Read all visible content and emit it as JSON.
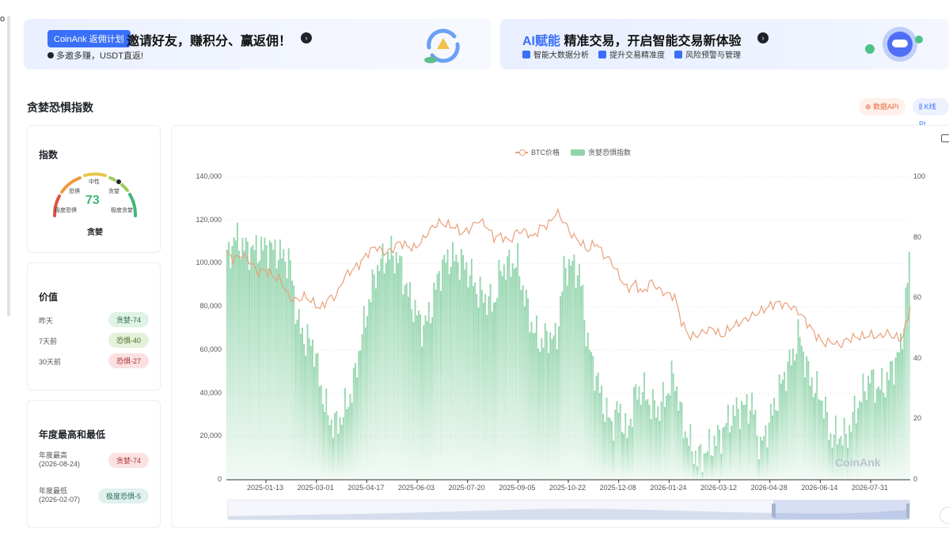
{
  "left_stub": "o",
  "banner1": {
    "badge": "CoinAnk 返佣计划",
    "title": "邀请好友，赚积分、赢返佣！",
    "subtitle": "多邀多赚，USDT直返!"
  },
  "banner2": {
    "title_ai": "AI赋能",
    "title_rest": " 精准交易，开启智能交易新体验",
    "features": [
      "智能大数据分析",
      "提升交易精准度",
      "风险预警与管理"
    ]
  },
  "page_title": "贪婪恐惧指数",
  "buttons": {
    "data_api": "数据API",
    "kline": "K线 PI"
  },
  "index_card": {
    "title": "指数",
    "value": "73",
    "state": "贪婪",
    "zones": {
      "extreme_fear": "极度恐惧",
      "fear": "恐惧",
      "neutral": "中性",
      "greed": "贪婪",
      "extreme_greed": "极度贪婪"
    },
    "colors": {
      "red": "#e0523f",
      "orange": "#ef9a3d",
      "yellow": "#e8c64a",
      "lightgreen": "#9fcd5a",
      "green": "#3fb877"
    }
  },
  "value_card": {
    "title": "价值",
    "rows": [
      {
        "label": "昨天",
        "chip": "贪婪-74"
      },
      {
        "label": "7天前",
        "chip": "恐惧-40"
      },
      {
        "label": "30天前",
        "chip": "恐惧-27"
      }
    ]
  },
  "year_card": {
    "title": "年度最高和最低",
    "rows": [
      {
        "label1": "年度最高",
        "label2": "(2026-08-24)",
        "chip": "贪婪-74"
      },
      {
        "label1": "年度最低",
        "label2": "(2026-02-07)",
        "chip": "极度恐惧-5"
      }
    ]
  },
  "watermark": "CoinAnk",
  "chart_data": {
    "type": "bar",
    "series": [
      {
        "name": "BTC价格",
        "render": "line",
        "axis": "left",
        "color": "#e8a07a"
      },
      {
        "name": "贪婪恐惧指数",
        "render": "bar",
        "axis": "right",
        "color": "#8fd3aa"
      }
    ],
    "x_ticks": [
      "2025-01-13",
      "2025-03-01",
      "2025-04-17",
      "2025-06-03",
      "2025-07-20",
      "2025-09-05",
      "2025-10-22",
      "2025-12-08",
      "2026-01-24",
      "2026-03-12",
      "2026-04-28",
      "2026-06-14",
      "2026-07-31"
    ],
    "y_left_ticks": [
      "140,000",
      "120,000",
      "100,000",
      "80,000",
      "60,000",
      "40,000",
      "20,000",
      "0"
    ],
    "y_right_ticks": [
      "100",
      "80",
      "60",
      "40",
      "20",
      "0"
    ],
    "ylim_left": [
      0,
      140000
    ],
    "ylim_right": [
      0,
      100
    ],
    "btc_price_samples": [
      105000,
      102000,
      104000,
      101000,
      96000,
      97000,
      94000,
      92000,
      84000,
      83000,
      85000,
      82000,
      79000,
      84000,
      85000,
      94000,
      97000,
      100000,
      105000,
      108000,
      105000,
      106000,
      110000,
      108000,
      107000,
      111000,
      116000,
      119000,
      118000,
      117000,
      114000,
      116000,
      120000,
      118000,
      112000,
      113000,
      110000,
      115000,
      115000,
      112000,
      117000,
      118000,
      124000,
      119000,
      113000,
      110000,
      106000,
      110000,
      104000,
      101000,
      94000,
      88000,
      91000,
      86000,
      92000,
      88000,
      86000,
      85000,
      72000,
      66000,
      67000,
      69000,
      70000,
      66000,
      70000,
      72000,
      74000,
      76000,
      78000,
      80000,
      82000,
      81000,
      80000,
      77000,
      72000,
      67000,
      63000,
      64000,
      62000,
      65000,
      66000,
      66000,
      67000,
      66000,
      68000,
      66000,
      65000,
      80000
    ],
    "fear_greed_samples": [
      73,
      80,
      77,
      76,
      76,
      77,
      76,
      74,
      72,
      52,
      46,
      45,
      30,
      20,
      18,
      23,
      30,
      45,
      58,
      69,
      73,
      75,
      72,
      62,
      56,
      50,
      56,
      68,
      73,
      73,
      72,
      68,
      62,
      60,
      58,
      70,
      71,
      72,
      60,
      50,
      45,
      48,
      46,
      70,
      71,
      68,
      45,
      35,
      25,
      18,
      24,
      14,
      28,
      30,
      25,
      23,
      28,
      35,
      20,
      12,
      7,
      9,
      12,
      15,
      20,
      23,
      24,
      25,
      10,
      18,
      26,
      34,
      40,
      48,
      36,
      30,
      26,
      14,
      15,
      14,
      22,
      28,
      34,
      30,
      32,
      38,
      44,
      72
    ]
  }
}
